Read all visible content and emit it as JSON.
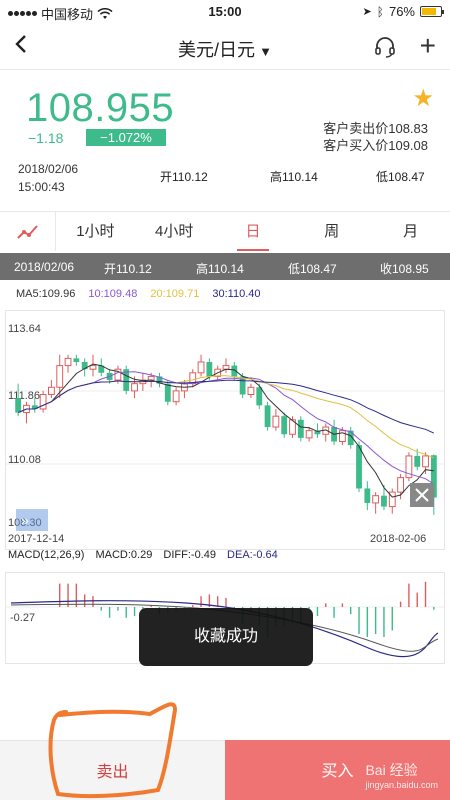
{
  "status": {
    "carrier": "中国移动",
    "time": "15:00",
    "battery": "76%",
    "battery_level": 0.76
  },
  "nav": {
    "title": "美元/日元",
    "caret": "▼",
    "back_icon": "chevron-left-icon",
    "service_icon": "headset-icon",
    "add_icon": "plus-icon"
  },
  "quote": {
    "price": "108.955",
    "change": "−1.18",
    "change_pct": "−1.072%",
    "sell_price": "客户卖出价108.83",
    "buy_price": "客户买入价109.08",
    "date": "2018/02/06",
    "time": "15:00:43",
    "open": "开110.12",
    "high": "高110.14",
    "low": "低108.47",
    "up_color": "#3dbb8a",
    "favorite_icon": "star-icon"
  },
  "tabs": [
    "1小时",
    "4小时",
    "日",
    "周",
    "月"
  ],
  "tab_icon": "line-chart-icon",
  "ohlc": {
    "date": "2018/02/06",
    "open": "开110.12",
    "high": "高110.14",
    "low": "低108.47",
    "close": "收108.95"
  },
  "ma": {
    "ma5": "MA5:109.96",
    "ma10": "10:109.48",
    "ma20": "20:109.71",
    "ma30": "30:110.40",
    "colors": {
      "ma5": "#333333",
      "ma10": "#8a56d6",
      "ma20": "#e0c040",
      "ma30": "#2a2a8a"
    }
  },
  "chart": {
    "y_top": "113.64",
    "y_mid": "111.86",
    "y_low": "110.08",
    "y_bottom": "108.30",
    "date_left": "2017-12-14",
    "date_right": "2018-02-06",
    "expand_icon": "double-chevron-right-icon",
    "crosshair_icon": "crosshair-icon",
    "up_color": "#e05c5c",
    "down_color": "#3dbb8a"
  },
  "chart_data": {
    "type": "candlestick",
    "ylim": [
      108.3,
      113.64
    ],
    "candles": [
      [
        111.7,
        112.1,
        111.2,
        111.3
      ],
      [
        111.3,
        111.6,
        111.0,
        111.5
      ],
      [
        111.5,
        111.7,
        111.3,
        111.4
      ],
      [
        111.4,
        111.9,
        111.3,
        111.8
      ],
      [
        111.8,
        112.2,
        111.7,
        112.0
      ],
      [
        112.0,
        112.9,
        111.7,
        112.6
      ],
      [
        112.6,
        112.9,
        112.4,
        112.8
      ],
      [
        112.8,
        112.9,
        112.6,
        112.7
      ],
      [
        112.7,
        112.8,
        112.3,
        112.5
      ],
      [
        112.5,
        112.9,
        112.3,
        112.6
      ],
      [
        112.6,
        112.8,
        112.3,
        112.4
      ],
      [
        112.4,
        112.5,
        112.1,
        112.2
      ],
      [
        112.2,
        112.6,
        112.1,
        112.5
      ],
      [
        112.5,
        112.6,
        111.8,
        111.9
      ],
      [
        111.9,
        112.3,
        111.7,
        112.1
      ],
      [
        112.1,
        112.4,
        111.9,
        112.2
      ],
      [
        112.2,
        112.4,
        112.0,
        112.3
      ],
      [
        112.3,
        112.4,
        112.0,
        112.1
      ],
      [
        112.1,
        112.2,
        111.5,
        111.6
      ],
      [
        111.6,
        112.0,
        111.5,
        111.9
      ],
      [
        111.9,
        112.2,
        111.7,
        112.1
      ],
      [
        112.1,
        112.5,
        112.0,
        112.4
      ],
      [
        112.4,
        112.9,
        112.3,
        112.7
      ],
      [
        112.7,
        112.8,
        112.2,
        112.3
      ],
      [
        112.3,
        112.6,
        112.2,
        112.5
      ],
      [
        112.5,
        112.8,
        112.4,
        112.6
      ],
      [
        112.6,
        112.7,
        112.2,
        112.3
      ],
      [
        112.3,
        112.4,
        111.7,
        111.8
      ],
      [
        111.8,
        112.1,
        111.7,
        112.0
      ],
      [
        112.0,
        112.1,
        111.4,
        111.5
      ],
      [
        111.5,
        111.6,
        110.8,
        110.9
      ],
      [
        110.9,
        111.4,
        110.8,
        111.2
      ],
      [
        111.2,
        111.3,
        110.6,
        110.7
      ],
      [
        110.7,
        111.2,
        110.6,
        111.1
      ],
      [
        111.1,
        111.2,
        110.5,
        110.6
      ],
      [
        110.6,
        110.9,
        110.5,
        110.8
      ],
      [
        110.8,
        111.0,
        110.6,
        110.7
      ],
      [
        110.7,
        111.0,
        110.5,
        110.9
      ],
      [
        110.9,
        111.1,
        110.4,
        110.5
      ],
      [
        110.5,
        110.9,
        110.4,
        110.8
      ],
      [
        110.8,
        110.9,
        110.3,
        110.4
      ],
      [
        110.4,
        110.5,
        109.1,
        109.2
      ],
      [
        109.2,
        109.4,
        108.6,
        108.8
      ],
      [
        108.8,
        109.1,
        108.5,
        109.0
      ],
      [
        109.0,
        109.3,
        108.6,
        108.7
      ],
      [
        108.7,
        109.2,
        108.5,
        109.1
      ],
      [
        109.1,
        109.6,
        108.9,
        109.5
      ],
      [
        109.5,
        110.2,
        109.4,
        110.1
      ],
      [
        110.1,
        110.3,
        109.7,
        109.8
      ],
      [
        109.8,
        110.2,
        109.6,
        110.1
      ],
      [
        110.12,
        110.14,
        108.47,
        108.95
      ]
    ]
  },
  "macd": {
    "label": "MACD(12,26,9)",
    "macd": "MACD:0.29",
    "diff": "DIFF:-0.49",
    "dea": "DEA:-0.64",
    "y_label": "-0.27",
    "dea_color": "#2a2a8a"
  },
  "toast": "收藏成功",
  "bottom": {
    "sell": "卖出",
    "buy": "买入"
  },
  "watermark": {
    "brand": "Bai 经验",
    "url": "jingyan.baidu.com"
  }
}
